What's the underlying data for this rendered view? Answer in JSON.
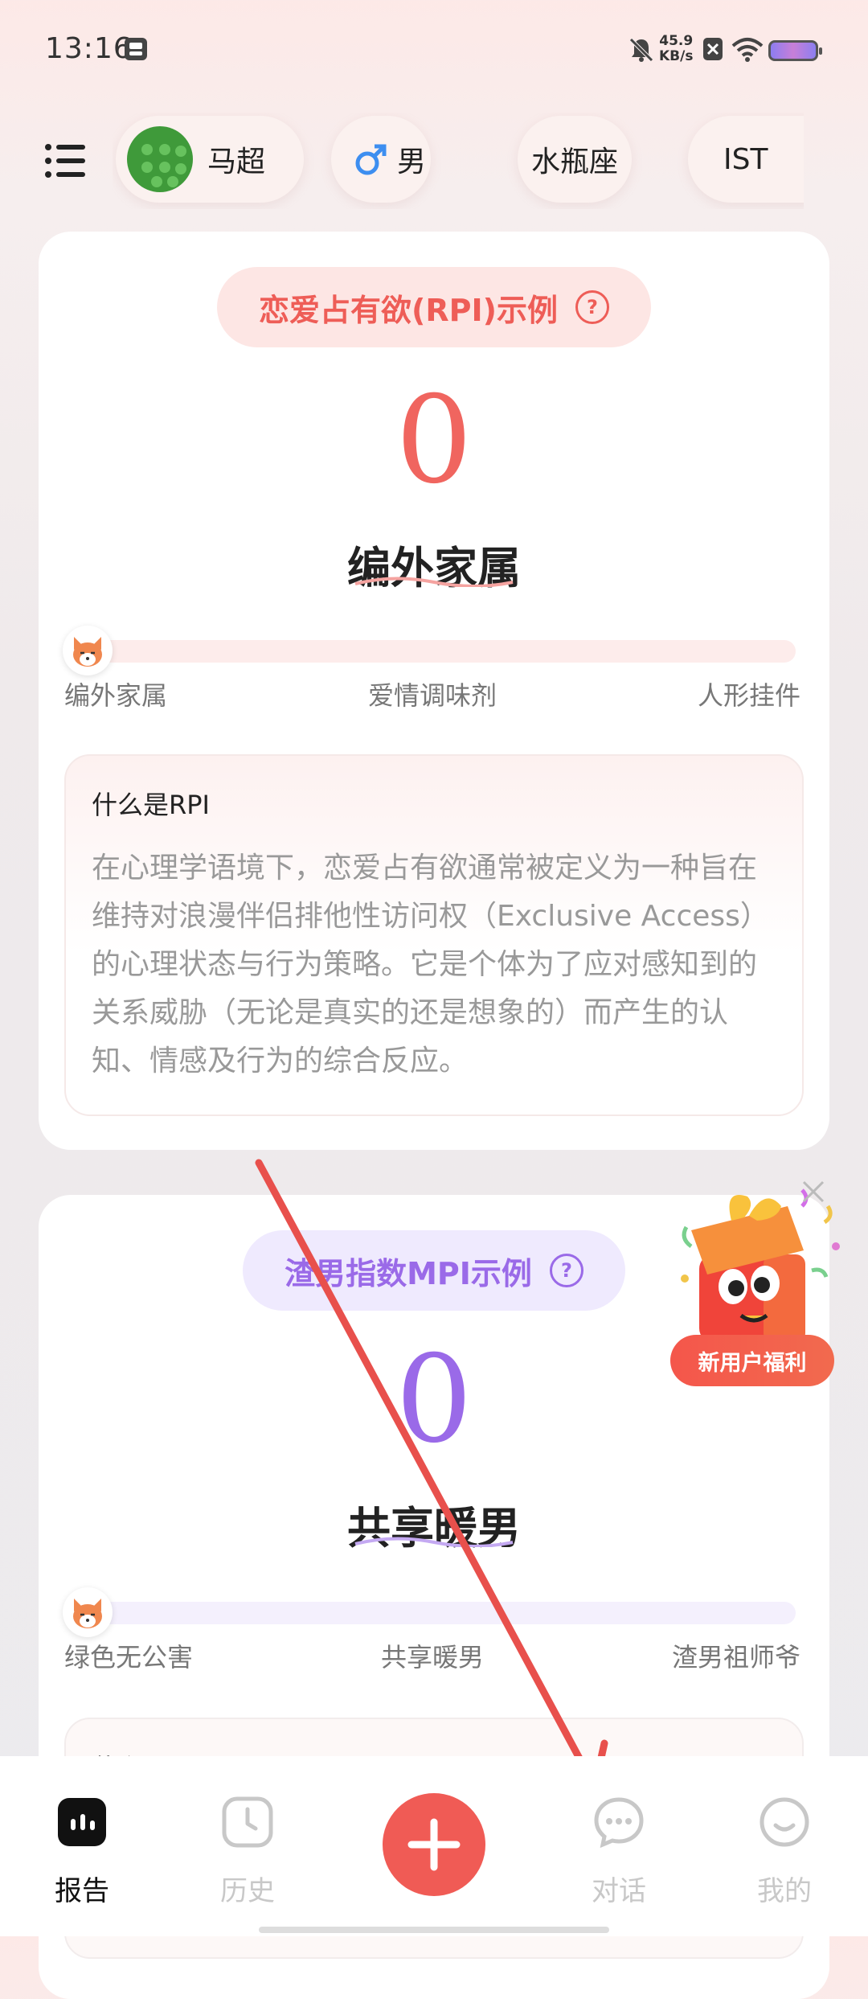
{
  "status_bar": {
    "time": "13:16",
    "net_speed_value": "45.9",
    "net_speed_unit": "KB/s"
  },
  "profile_chips": [
    {
      "label": "马超",
      "icon": "avatar"
    },
    {
      "label": "男",
      "icon": "male-icon"
    },
    {
      "label": "水瓶座"
    },
    {
      "label": "IST"
    }
  ],
  "cards": [
    {
      "title": "恋爱占有欲(RPI)示例",
      "score": "0",
      "level": "编外家属",
      "level_position": 0,
      "scale": [
        "编外家属",
        "爱情调味剂",
        "人形挂件"
      ],
      "info_title": "什么是RPI",
      "info_body": "在心理学语境下，恋爱占有欲通常被定义为一种旨在维持对浪漫伴侣排他性访问权（Exclusive Access）的心理状态与行为策略。它是个体为了应对感知到的关系威胁（无论是真实的还是想象的）而产生的认知、情感及行为的综合反应。",
      "accent": "#f0655f"
    },
    {
      "title": "渣男指数MPI示例",
      "score": "0",
      "level": "共享暖男",
      "level_position": 0,
      "scale": [
        "绿色无公害",
        "共享暖男",
        "渣男祖师爷"
      ],
      "info_title": "什么是MPI",
      "accent": "#9a6ae8"
    }
  ],
  "promo": {
    "label": "新用户福利"
  },
  "tabbar": {
    "tabs": [
      {
        "label": "报告",
        "icon": "report-icon",
        "active": true
      },
      {
        "label": "历史",
        "icon": "clock-icon",
        "active": false
      },
      {
        "label": "对话",
        "icon": "chat-icon",
        "active": false
      },
      {
        "label": "我的",
        "icon": "smile-icon",
        "active": false
      }
    ],
    "add_icon": "plus-icon"
  },
  "colors": {
    "primary": "#f05b55",
    "rpi_accent": "#f0655f",
    "mpi_accent": "#9a6ae8",
    "annotation_arrow": "#e8504c"
  }
}
